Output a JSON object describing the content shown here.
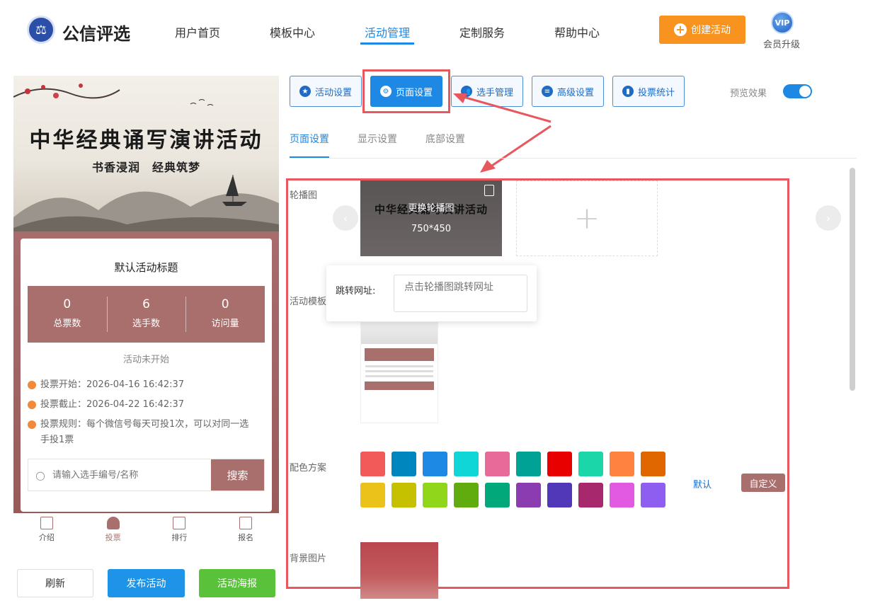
{
  "header": {
    "logo_text": "公信评选",
    "nav": [
      "用户首页",
      "模板中心",
      "活动管理",
      "定制服务",
      "帮助中心"
    ],
    "create_label": "创建活动",
    "vip_badge": "VIP",
    "vip_label": "会员升级"
  },
  "preview": {
    "banner_title": "中华经典诵写演讲活动",
    "banner_sub": "书香浸润　经典筑梦",
    "card_title": "默认活动标题",
    "stats": [
      {
        "num": "0",
        "label": "总票数"
      },
      {
        "num": "6",
        "label": "选手数"
      },
      {
        "num": "0",
        "label": "访问量"
      }
    ],
    "status": "活动未开始",
    "vote_start": "投票开始：2026-04-16 16:42:37",
    "vote_end": "投票截止：2026-04-22 16:42:37",
    "vote_rule": "投票规则：每个微信号每天可投1次，可以对同一选手投1票",
    "search_placeholder": "请输入选手编号/名称",
    "search_btn": "搜索",
    "tabs": [
      "介绍",
      "投票",
      "排行",
      "报名"
    ]
  },
  "footer_buttons": {
    "refresh": "刷新",
    "publish": "发布活动",
    "poster": "活动海报"
  },
  "toolbar": {
    "buttons": [
      "活动设置",
      "页面设置",
      "选手管理",
      "高级设置",
      "投票统计"
    ],
    "preview_label": "预览效果"
  },
  "subtabs": [
    "页面设置",
    "显示设置",
    "底部设置"
  ],
  "settings": {
    "carousel_label": "轮播图",
    "carousel_overlay": "更换轮播图",
    "carousel_size": "750*450",
    "carousel_title": "中华经典诵写演讲活动",
    "jump_label": "跳转网址:",
    "jump_placeholder": "点击轮播图跳转网址",
    "template_label": "活动模板",
    "color_label": "配色方案",
    "default_link": "默认",
    "custom_btn": "自定义",
    "bg_label": "背景图片"
  },
  "colors": {
    "accent": "#1e88e5",
    "theme": "#a96f6d",
    "swatches": [
      "#f25a5a",
      "#0086bf",
      "#1e88e5",
      "#11d6d8",
      "#e86a99",
      "#00a296",
      "#e80000",
      "#1bd6a8",
      "#ff8240",
      "#e06600",
      "#eac21a",
      "#c5c000",
      "#90d61a",
      "#60ac0f",
      "#00a87a",
      "#8a3cb0",
      "#5038b8",
      "#a8286e",
      "#e25ae2",
      "#8e5ef0"
    ]
  }
}
